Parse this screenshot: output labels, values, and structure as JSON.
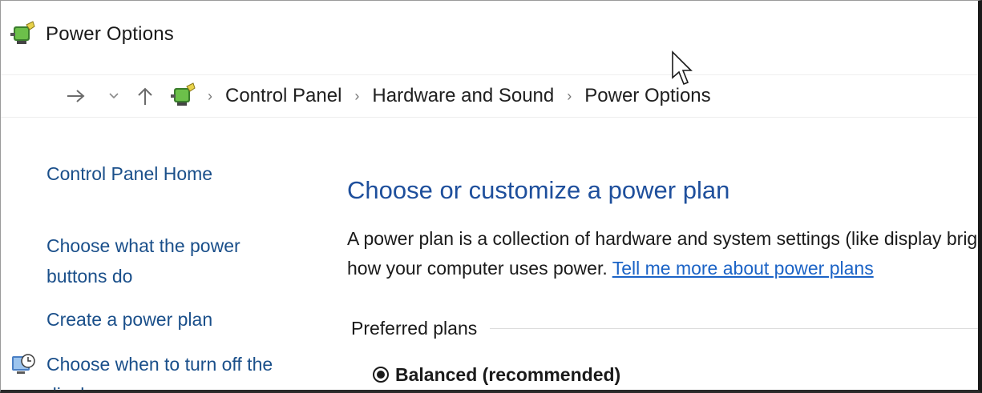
{
  "window": {
    "title": "Power Options",
    "icon": "power-options-icon"
  },
  "addressbar": {
    "forward_icon": "arrow-right-icon",
    "history_icon": "chevron-down-icon",
    "up_icon": "arrow-up-icon",
    "breadcrumbs": [
      "Control Panel",
      "Hardware and Sound",
      "Power Options"
    ]
  },
  "sidebar": {
    "items": [
      {
        "label": "Control Panel Home"
      },
      {
        "label_line1": "Choose what the power",
        "label_line2": "buttons do"
      },
      {
        "label": "Create a power plan"
      },
      {
        "label_line1": "Choose when to turn off the",
        "label_line2": "display"
      }
    ]
  },
  "main": {
    "heading": "Choose or customize a power plan",
    "description_line1": "A power plan is a collection of hardware and system settings (like display brig",
    "description_line2_prefix": "how your computer uses power. ",
    "learn_more_link": "Tell me more about power plans",
    "preferred_plans_label": "Preferred plans",
    "plans": [
      {
        "label": "Balanced (recommended)",
        "selected": true
      }
    ]
  },
  "colors": {
    "link": "#1a4f8a",
    "heading": "#1e4f9c",
    "hyperlink": "#1b63c6"
  }
}
